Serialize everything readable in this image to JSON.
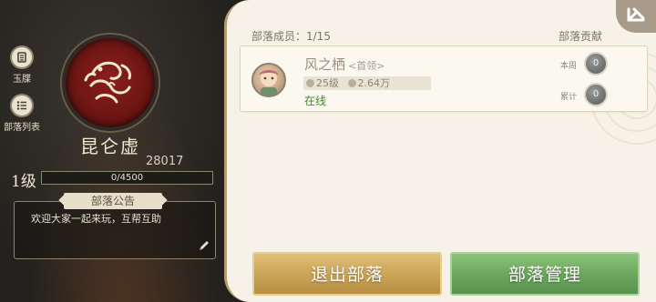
{
  "sidebar": {
    "items": [
      {
        "label": "玉牒",
        "icon": "scroll-icon"
      },
      {
        "label": "部落列表",
        "icon": "list-icon"
      }
    ]
  },
  "tribe": {
    "name": "昆仑虚",
    "emblem_icon": "tiger-emblem-icon",
    "score": "28017",
    "level": "1级",
    "xp_text": "0/4500",
    "xp_progress": 0.0
  },
  "notice": {
    "title": "部落公告",
    "text": "欢迎大家一起来玩，互帮互助"
  },
  "members_header": {
    "label": "部落成员：1/15",
    "contribution_label": "部落贡献"
  },
  "members": [
    {
      "name": "风之栖",
      "role": "<首领>",
      "level": "25级",
      "power": "2.64万",
      "status": "在线",
      "weekly_label": "本周",
      "weekly_value": "0",
      "total_label": "累计",
      "total_value": "0"
    }
  ],
  "actions": {
    "exit_label": "退出部落",
    "manage_label": "部落管理"
  },
  "colors": {
    "online": "#3e8a2e",
    "exit_button": "#c9a255",
    "manage_button": "#6aa55b",
    "emblem_red": "#8a1f1b"
  }
}
